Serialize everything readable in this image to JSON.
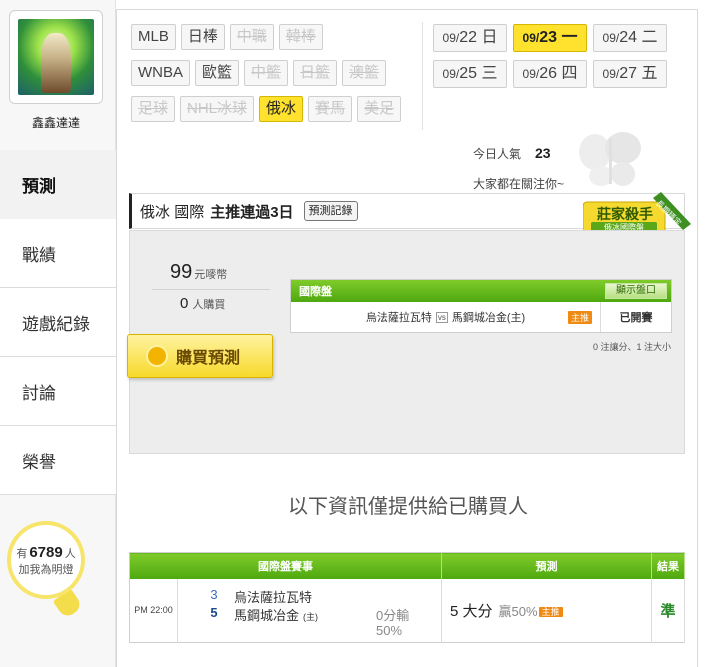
{
  "user": {
    "name": "鑫鑫達達"
  },
  "nav": [
    {
      "label": "預測",
      "active": true
    },
    {
      "label": "戰績",
      "active": false
    },
    {
      "label": "遊戲紀錄",
      "active": false
    },
    {
      "label": "討論",
      "active": false
    },
    {
      "label": "榮譽",
      "active": false
    }
  ],
  "fans": {
    "prefix": "有",
    "count": "6789",
    "unit": "人",
    "cta": "加我為明燈"
  },
  "categories": [
    [
      {
        "label": "MLB"
      },
      {
        "label": "日棒"
      },
      {
        "label": "中職",
        "disabled": true
      },
      {
        "label": "韓棒",
        "disabled": true
      }
    ],
    [
      {
        "label": "WNBA"
      },
      {
        "label": "歐籃"
      },
      {
        "label": "中籃",
        "disabled": true
      },
      {
        "label": "日籃",
        "disabled": true
      },
      {
        "label": "澳籃",
        "disabled": true
      }
    ],
    [
      {
        "label": "足球",
        "disabled": true
      },
      {
        "label": "NHL冰球",
        "disabled": true
      },
      {
        "label": "俄冰",
        "selected": true
      },
      {
        "label": "賽馬",
        "disabled": true
      },
      {
        "label": "美足",
        "disabled": true
      }
    ]
  ],
  "dates": [
    {
      "month": "09/",
      "day": "22",
      "weekday": "日"
    },
    {
      "month": "09/",
      "day": "23",
      "weekday": "一",
      "selected": true
    },
    {
      "month": "09/",
      "day": "24",
      "weekday": "二"
    },
    {
      "month": "09/",
      "day": "25",
      "weekday": "三"
    },
    {
      "month": "09/",
      "day": "26",
      "weekday": "四"
    },
    {
      "month": "09/",
      "day": "27",
      "weekday": "五"
    }
  ],
  "popularity": {
    "today_label": "今日人氣",
    "today_value": "23",
    "follow_text": "大家都在關注你~"
  },
  "header": {
    "league": "俄冰",
    "market": "國際",
    "streak": "主推連過3日",
    "record_button": "預測記錄"
  },
  "badge": {
    "title": "莊家殺手",
    "subtitle": "俄冰國際盤",
    "ribbon": "長期穩定"
  },
  "colors": {
    "accent_yellow": "#ffe22e",
    "header_green": "#5cb31a",
    "tag_orange": "#f08a12",
    "result_green": "#2a8a2a"
  },
  "purchase": {
    "price": "99",
    "price_unit": "元嘜幣",
    "buyers": "0",
    "buyers_unit": "人購買",
    "buy_button": "購買預測",
    "odds_title": "國際盤",
    "show_button": "顯示盤口",
    "match_away": "烏法薩拉瓦特",
    "vs": "vs",
    "match_home": "馬鋼城冶金(主)",
    "tag": "主推",
    "status": "已開賽",
    "note": "0 注讓分、1 注大小"
  },
  "info_text": "以下資訊僅提供給已購買人",
  "results": {
    "headers": [
      "國際盤賽事",
      "預測",
      "結果"
    ],
    "rows": [
      {
        "time": "PM 22:00",
        "score_away": "3",
        "team_away": "烏法薩拉瓦特",
        "score_home": "5",
        "team_home": "馬鋼城冶金",
        "home_mark": "(主)",
        "line": "0分輸",
        "pct": "50%",
        "prediction": "5 大分",
        "win_rate": "贏50%",
        "pred_tag": "主推",
        "result": "準"
      }
    ]
  }
}
